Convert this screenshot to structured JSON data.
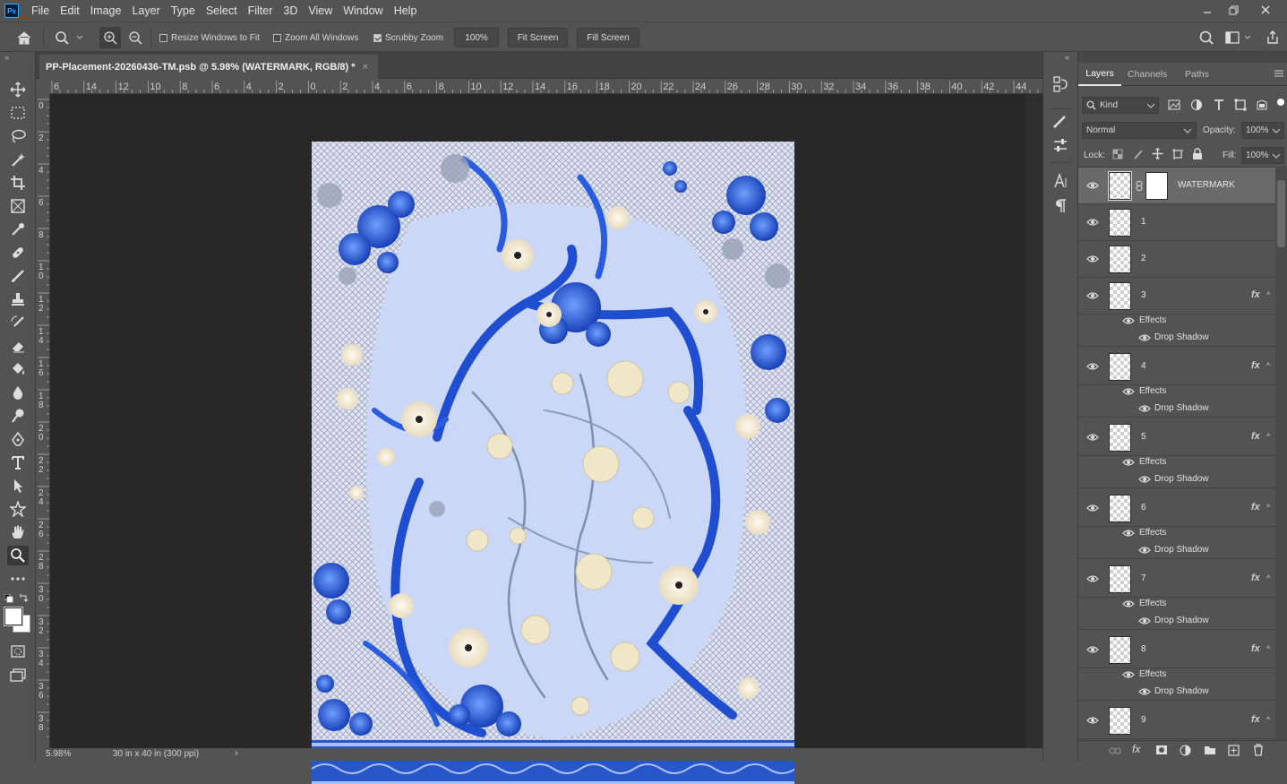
{
  "app": {
    "logo": "Ps"
  },
  "menu": [
    "File",
    "Edit",
    "Image",
    "Layer",
    "Type",
    "Select",
    "Filter",
    "3D",
    "View",
    "Window",
    "Help"
  ],
  "options": {
    "resize_windows": {
      "label": "Resize Windows to Fit",
      "checked": false
    },
    "zoom_all": {
      "label": "Zoom All Windows",
      "checked": false
    },
    "scrubby": {
      "label": "Scrubby Zoom",
      "checked": true
    },
    "zoom_value": "100%",
    "fit_screen": "Fit Screen",
    "fill_screen": "Fill Screen"
  },
  "document": {
    "tab_title": "PP-Placement-20260436-TM.psb @ 5.98% (WATERMARK, RGB/8) *",
    "close": "×"
  },
  "ruler": {
    "h_labels": [
      "6",
      "14",
      "12",
      "10",
      "8",
      "6",
      "4",
      "2",
      "0",
      "2",
      "4",
      "6",
      "8",
      "10",
      "12",
      "14",
      "16",
      "18",
      "20",
      "22",
      "24",
      "26",
      "28",
      "30",
      "32",
      "34",
      "36",
      "38",
      "40",
      "42",
      "44"
    ],
    "v_labels": [
      "0",
      "2",
      "4",
      "6",
      "8",
      "10",
      "12",
      "14",
      "16",
      "18",
      "20",
      "22",
      "24",
      "26",
      "28",
      "30",
      "32",
      "34",
      "36",
      "38"
    ]
  },
  "status": {
    "zoom": "5.98%",
    "info": "30 in x 40 in (300 ppi)",
    "arrow": "›"
  },
  "panel": {
    "tabs": [
      "Layers",
      "Channels",
      "Paths"
    ],
    "active_tab": "Layers",
    "filter_kind": "Kind",
    "blend_mode": "Normal",
    "opacity_label": "Opacity:",
    "opacity_value": "100%",
    "lock_label": "Lock:",
    "fill_label": "Fill:",
    "fill_value": "100%",
    "effects_label": "Effects",
    "drop_shadow_label": "Drop Shadow",
    "layers": [
      {
        "name": "WATERMARK",
        "selected": true,
        "fx": false,
        "mask": true
      },
      {
        "name": "1",
        "fx": false
      },
      {
        "name": "2",
        "fx": false
      },
      {
        "name": "3",
        "fx": true
      },
      {
        "name": "4",
        "fx": true
      },
      {
        "name": "5",
        "fx": true
      },
      {
        "name": "6",
        "fx": true
      },
      {
        "name": "7",
        "fx": true
      },
      {
        "name": "8",
        "fx": true
      },
      {
        "name": "9",
        "fx": true
      }
    ]
  },
  "colors": {
    "accent_blue": "#2f5fd0",
    "canvas_bg": "#cad6f6",
    "ui_bg": "#535353"
  }
}
